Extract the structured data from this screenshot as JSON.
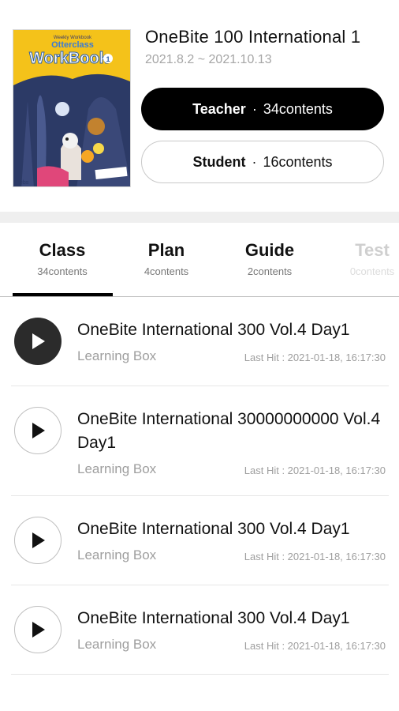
{
  "book": {
    "title": "OneBite 100 International 1",
    "date_range": "2021.8.2 ~ 2021.10.13",
    "cover": {
      "small_text": "Weekly Workbook",
      "brand_word": "Otterclass",
      "main_word": "WorkBook",
      "badge": "1",
      "logo": "ebs"
    }
  },
  "buttons": {
    "teacher": {
      "role": "Teacher",
      "sep": "·",
      "count": "34contents"
    },
    "student": {
      "role": "Student",
      "sep": "·",
      "count": "16contents"
    }
  },
  "tabs": [
    {
      "label": "Class",
      "count": "34contents",
      "active": true
    },
    {
      "label": "Plan",
      "count": "4contents",
      "active": false
    },
    {
      "label": "Guide",
      "count": "2contents",
      "active": false
    },
    {
      "label": "Test",
      "count": "0contents",
      "active": false
    }
  ],
  "items": [
    {
      "title": "OneBite International 300 Vol.4 Day1",
      "sub": "Learning Box",
      "hit": "Last Hit : 2021-01-18, 16:17:30",
      "playing": true
    },
    {
      "title": "OneBite International 30000000000 Vol.4 Day1",
      "sub": "Learning Box",
      "hit": "Last Hit : 2021-01-18, 16:17:30",
      "playing": false
    },
    {
      "title": "OneBite International 300 Vol.4 Day1",
      "sub": "Learning Box",
      "hit": "Last Hit : 2021-01-18, 16:17:30",
      "playing": false
    },
    {
      "title": "OneBite International 300 Vol.4 Day1",
      "sub": "Learning Box",
      "hit": "Last Hit : 2021-01-18, 16:17:30",
      "playing": false
    }
  ],
  "icons": {
    "play": "play-icon"
  },
  "colors": {
    "accent": "#000000",
    "cover_bg": "#f4c21a",
    "muted_text": "#9e9e9e"
  }
}
